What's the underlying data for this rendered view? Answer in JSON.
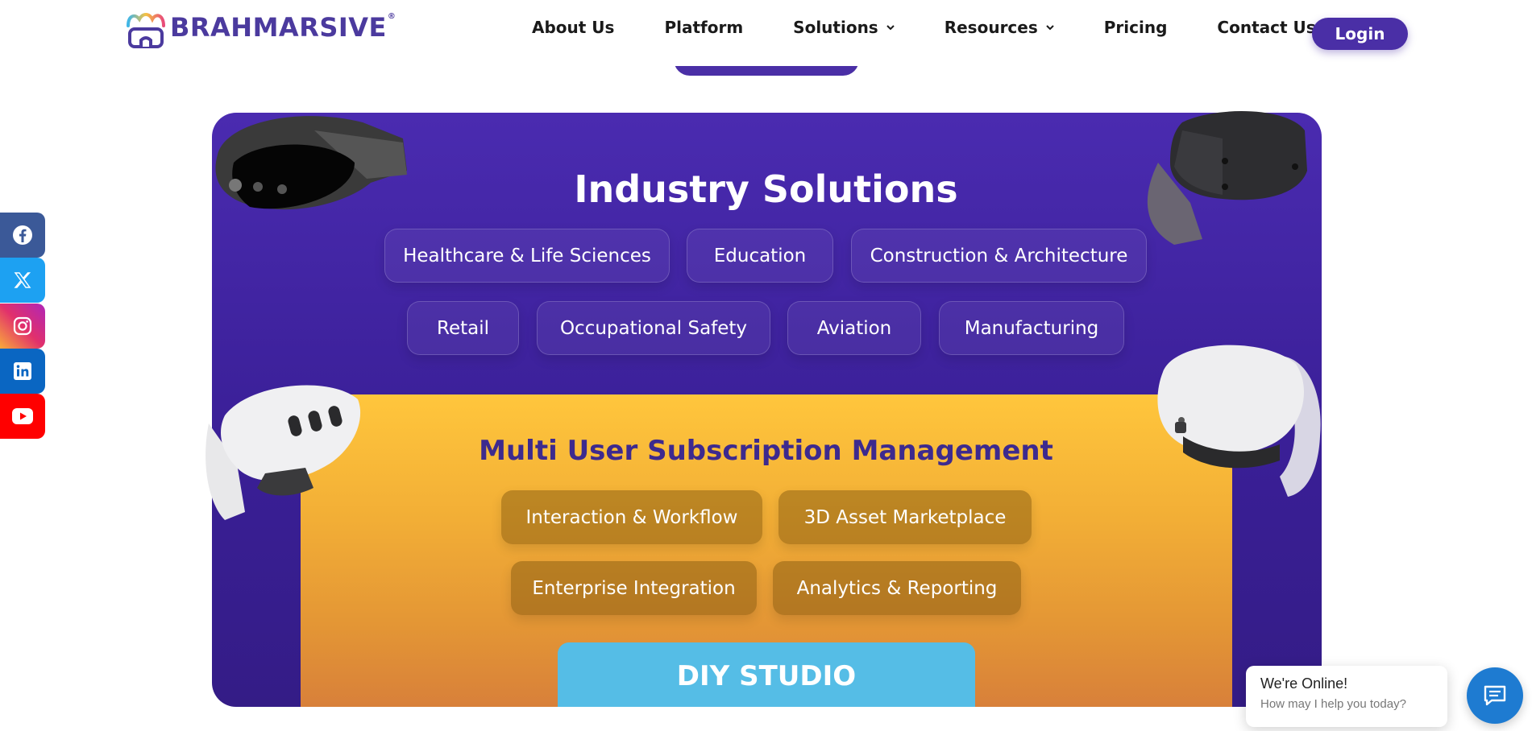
{
  "brand": {
    "name": "BRAHMARSIVE",
    "reg": "®",
    "color": "#4b3a9e"
  },
  "nav": {
    "items": [
      {
        "label": "About Us",
        "dropdown": false
      },
      {
        "label": "Platform",
        "dropdown": false
      },
      {
        "label": "Solutions",
        "dropdown": true
      },
      {
        "label": "Resources",
        "dropdown": true
      },
      {
        "label": "Pricing",
        "dropdown": false
      },
      {
        "label": "Contact Us",
        "dropdown": false
      }
    ],
    "login_label": "Login"
  },
  "industry": {
    "title": "Industry Solutions",
    "chips": [
      "Healthcare & Life Sciences",
      "Education",
      "Construction & Architecture",
      "Retail",
      "Occupational Safety",
      "Aviation",
      "Manufacturing"
    ]
  },
  "subscription": {
    "title": "Multi User Subscription Management",
    "chips": [
      "Interaction & Workflow",
      "3D Asset Marketplace",
      "Enterprise Integration",
      "Analytics & Reporting"
    ],
    "cta_label": "DIY STUDIO"
  },
  "social": [
    {
      "name": "facebook",
      "icon": "facebook-icon",
      "color": "#3b5998"
    },
    {
      "name": "x",
      "icon": "x-icon",
      "color": "#1da1f2"
    },
    {
      "name": "instagram",
      "icon": "instagram-icon",
      "color": "#d6249f"
    },
    {
      "name": "linkedin",
      "icon": "linkedin-icon",
      "color": "#0a66c2"
    },
    {
      "name": "youtube",
      "icon": "youtube-icon",
      "color": "#ff0000"
    }
  ],
  "chat": {
    "line1": "We're Online!",
    "line2": "How may I help you today?"
  },
  "colors": {
    "primary": "#4a2fa6",
    "card_top": "#4a2bb0",
    "card_bottom": "#341c86",
    "gold_top": "#ffc63c",
    "gold_bottom": "#d8803a",
    "diy": "#55bde6",
    "chat": "#1e7bd1"
  }
}
